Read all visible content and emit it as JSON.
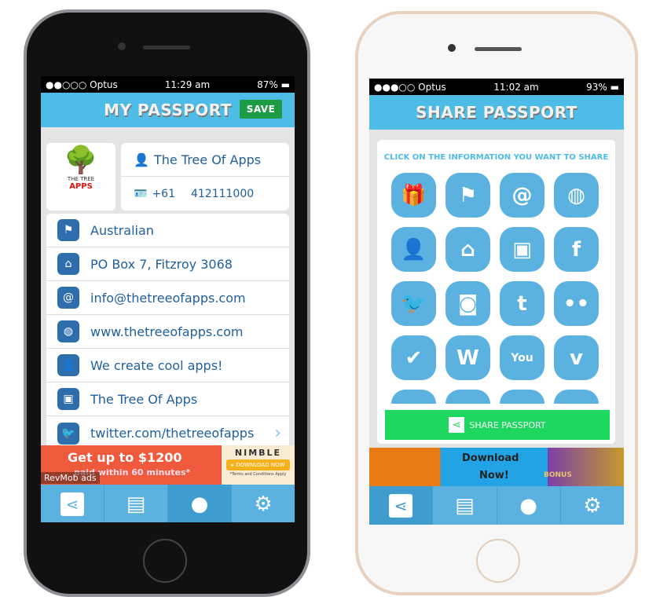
{
  "left": {
    "status": {
      "carrier": "●●○○○ Optus",
      "wifi": "wifi-icon",
      "time": "11:29 am",
      "battery": "87%"
    },
    "header": {
      "title": "MY PASSPORT",
      "save": "SAVE"
    },
    "logo": {
      "line1": "THE TREE",
      "line2": "APPS"
    },
    "name": "The Tree Of Apps",
    "phone_code": "+61",
    "phone": "412111000",
    "rows": [
      "Australian",
      "PO Box 7, Fitzroy 3068",
      "info@thetreeofapps.com",
      "www.thetreeofapps.com",
      "We create cool apps!",
      "The Tree Of Apps",
      "twitter.com/thetreeofapps"
    ],
    "ad": {
      "headline": "Get up to $1200",
      "sub": "paid within 60 minutes*",
      "brand": "NIMBLE",
      "cta": "▸ DOWNLOAD NOW",
      "terms": "*Terms and Conditions Apply",
      "network": "RevMob ads"
    }
  },
  "right": {
    "status": {
      "carrier": "●●●○○ Optus",
      "time": "11:02 am",
      "battery": "93%"
    },
    "header": {
      "title": "SHARE PASSPORT"
    },
    "instruction": "CLICK ON THE INFORMATION YOU WANT TO SHARE",
    "icons": [
      "gift",
      "flag",
      "at",
      "globe",
      "person",
      "home",
      "briefcase",
      "facebook",
      "twitter",
      "instagram",
      "tumblr",
      "flickr",
      "checkmark",
      "wordpress",
      "youtube",
      "vimeo"
    ],
    "share_button": "SHARE PASSPORT",
    "ad": {
      "line1": "Download",
      "line2": "Now!",
      "badge": "BONUS"
    }
  },
  "colors": {
    "header": "#4dbde8",
    "save": "#1e9c45",
    "share": "#1ed760",
    "icon": "#5bb2e1",
    "text": "#1f5f9c"
  }
}
